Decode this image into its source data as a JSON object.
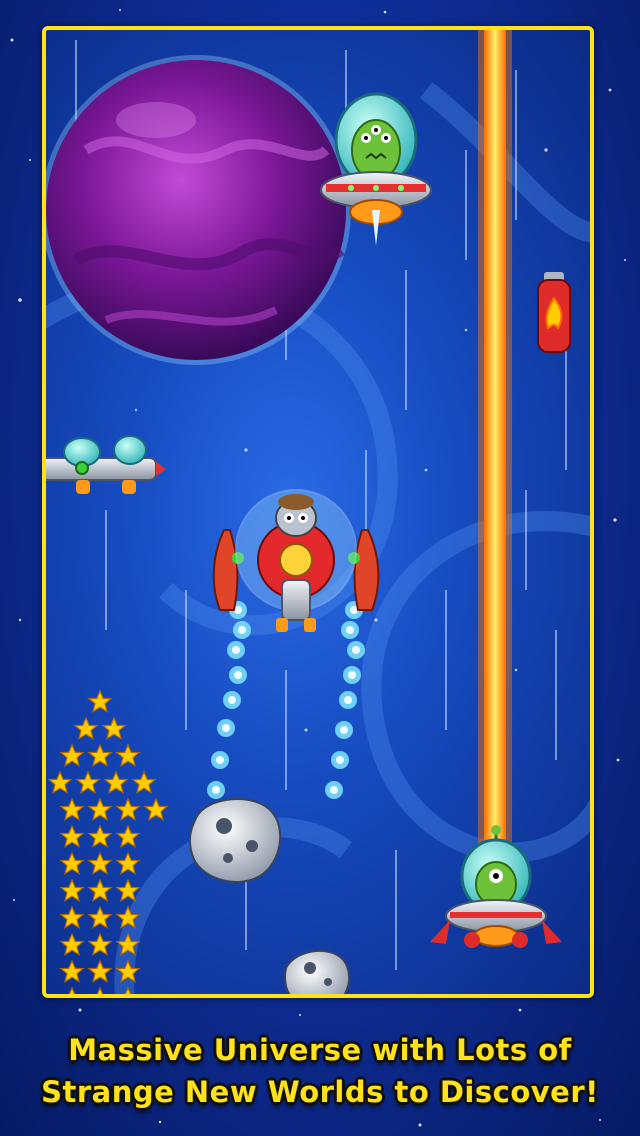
{
  "caption": {
    "line1": "Massive Universe with Lots of",
    "line2": "Strange New Worlds to Discover!"
  },
  "colors": {
    "frame": "#ffe21a",
    "space_dark": "#0b2a85",
    "space_light": "#2a6be6",
    "planet": "#8a1fa8",
    "laser": "#ffb400",
    "star": "#ffcc00",
    "caption_text": "#ffe21a"
  },
  "game": {
    "player": {
      "name": "sheep-pilot-spaceship",
      "icon": "sheep-spaceship-icon"
    },
    "enemies": [
      {
        "name": "alien-ufo-top",
        "icon": "three-eyed-alien-ufo-icon"
      },
      {
        "name": "alien-ufo-bottom",
        "icon": "one-eyed-alien-ufo-icon"
      },
      {
        "name": "alien-ship-left",
        "icon": "twin-pod-ship-icon"
      }
    ],
    "pickups": [
      {
        "name": "fire-canister",
        "icon": "fire-extinguisher-powerup-icon"
      }
    ],
    "hazards": [
      {
        "name": "asteroid",
        "icon": "asteroid-icon"
      }
    ],
    "effects": [
      {
        "name": "laser-beam",
        "icon": "laser-beam-icon"
      }
    ],
    "collectibles": {
      "type": "gold-star",
      "icon": "star-icon",
      "visible_count": 53
    }
  }
}
